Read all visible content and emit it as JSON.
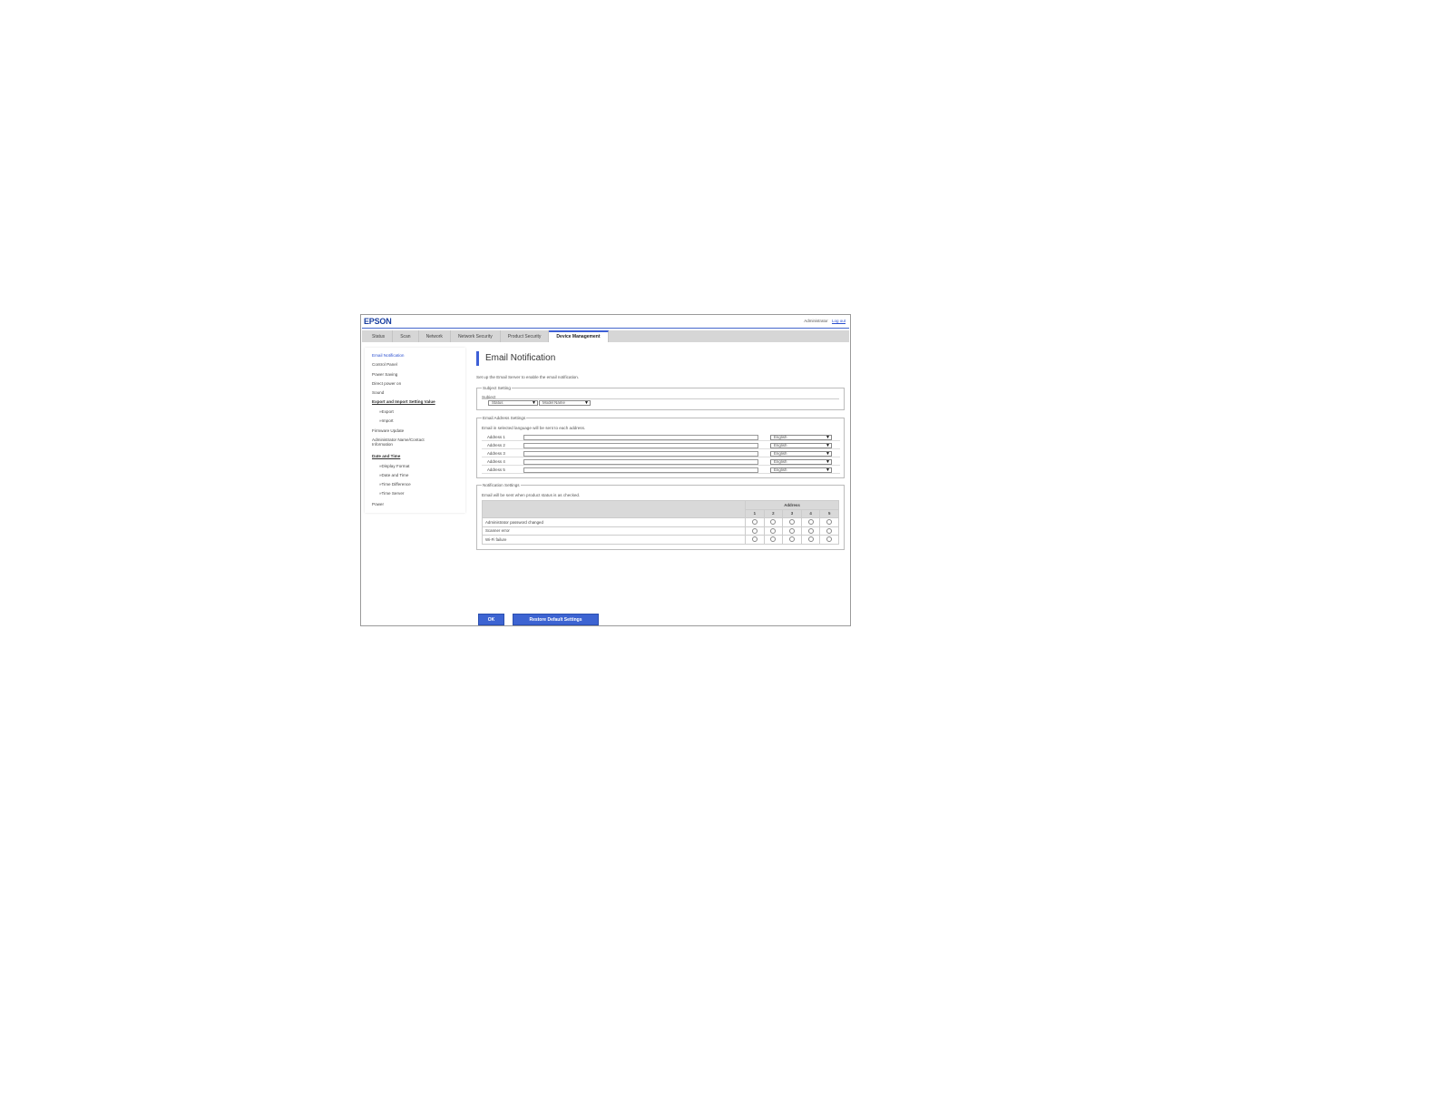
{
  "header": {
    "logo": "EPSON",
    "user": "Administrator",
    "logout": "Log out"
  },
  "tabs": [
    {
      "label": "Status"
    },
    {
      "label": "Scan"
    },
    {
      "label": "Network"
    },
    {
      "label": "Network Security"
    },
    {
      "label": "Product Security"
    },
    {
      "label": "Device Management"
    }
  ],
  "active_tab": "Device Management",
  "sidebar": {
    "items": [
      {
        "label": "Email Notification"
      },
      {
        "label": "Control Panel"
      },
      {
        "label": "Power Saving"
      },
      {
        "label": "Direct power on"
      },
      {
        "label": "Sound"
      },
      {
        "label": "Export and Import Setting Value"
      },
      {
        "label": "»Export"
      },
      {
        "label": "»Import"
      },
      {
        "label": "Firmware Update"
      },
      {
        "label": "Administrator Name/Contact Information"
      },
      {
        "label": "Date and Time"
      },
      {
        "label": "»Display Format"
      },
      {
        "label": "»Date and Time"
      },
      {
        "label": "»Time Difference"
      },
      {
        "label": "»Time Server"
      },
      {
        "label": "Power"
      }
    ]
  },
  "main": {
    "title": "Email Notification",
    "description": "Set up the Email Server to enable the email notification.",
    "subject": {
      "legend": "Subject Setting",
      "label": "Subject",
      "select1": "Status",
      "select2": "Model Name"
    },
    "addresses": {
      "legend": "Email Address Settings",
      "note": "Email in selected language will be sent to each address.",
      "rows": [
        {
          "label": "Address 1",
          "value": "",
          "language": "English"
        },
        {
          "label": "Address 2",
          "value": "",
          "language": "English"
        },
        {
          "label": "Address 3",
          "value": "",
          "language": "English"
        },
        {
          "label": "Address 4",
          "value": "",
          "language": "English"
        },
        {
          "label": "Address 5",
          "value": "",
          "language": "English"
        }
      ]
    },
    "notifications": {
      "legend": "Notification Settings",
      "note": "Email will be sent when product status is as checked.",
      "address_header": "Address",
      "columns": [
        "1",
        "2",
        "3",
        "4",
        "5"
      ],
      "rows": [
        {
          "label": "Administrator password changed"
        },
        {
          "label": "Scanner error"
        },
        {
          "label": "Wi-Fi failure"
        }
      ]
    },
    "buttons": {
      "ok": "OK",
      "restore": "Restore Default Settings"
    }
  }
}
